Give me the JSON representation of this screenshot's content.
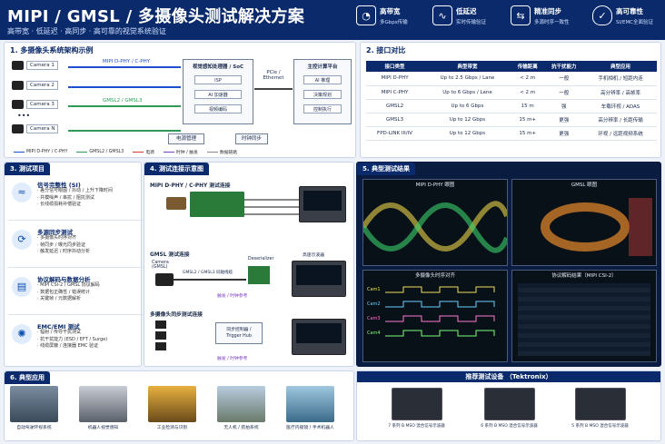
{
  "header": {
    "title": "MIPI / GMSL / 多摄像头测试解决方案",
    "subtitle": "高带宽 · 低延迟 · 高同步 · 高可靠的视觉系统验证",
    "features": [
      {
        "icon": "speedometer-icon",
        "title": "高带宽",
        "sub": "多Gbps传输"
      },
      {
        "icon": "pulse-icon",
        "title": "低延迟",
        "sub": "实时传输验证"
      },
      {
        "icon": "sync-icon",
        "title": "精准同步",
        "sub": "多源时序一致性"
      },
      {
        "icon": "shield-icon",
        "title": "高可靠性",
        "sub": "SI/EMC全面验证"
      }
    ]
  },
  "arch": {
    "title": "1. 多摄像头系统架构示例",
    "cameras": [
      "Camera 1",
      "Camera 2",
      "Camera 3",
      "Camera N"
    ],
    "link1": "MIPI D-PHY / C-PHY",
    "link2": "GMSL2 / GMSL3",
    "soc": "视觉感知处理器 / SoC",
    "soc_items": [
      "ISP",
      "AI 加速器",
      "视频编码"
    ],
    "pcie": "PCIe / Ethernet",
    "host": "主控计算平台",
    "host_items": [
      "AI 推理",
      "决策规划",
      "控制执行"
    ],
    "power": "电源管理",
    "clock": "时钟同步",
    "legend": [
      "MIPI D-PHY / C-PHY",
      "GMSL2 / GMSL3",
      "电源",
      "时钟 / 触发",
      "数据链路"
    ]
  },
  "compare": {
    "title": "2. 接口对比",
    "headers": [
      "接口类型",
      "典型带宽",
      "传输距离",
      "抗干扰能力",
      "典型应用"
    ],
    "rows": [
      [
        "MIPI D-PHY",
        "Up to 2.5 Gbps / Lane",
        "< 2 m",
        "一般",
        "手机相机 / 短距内连"
      ],
      [
        "MIPI C-PHY",
        "Up to 6 Gbps / Lane",
        "< 2 m",
        "一般",
        "高分辨率 / 高帧率"
      ],
      [
        "GMSL2",
        "Up to 6 Gbps",
        "15 m",
        "强",
        "车载环视 / ADAS"
      ],
      [
        "GMSL3",
        "Up to 12 Gbps",
        "15 m+",
        "更强",
        "高分辨率 / 长距传输"
      ],
      [
        "FPD-LINK III/IV",
        "Up to 12 Gbps",
        "15 m+",
        "更强",
        "环视 / 远距视频系统"
      ]
    ]
  },
  "tests": {
    "title": "3. 测试项目",
    "items": [
      {
        "icon": "eye-diagram-icon",
        "title": "信号完整性 (SI)",
        "lines": [
          "· 差分信号眼图 / 抖动 / 上升下降时间",
          "· 共模噪声 / 串扰 / 阻抗测试",
          "· 长线缆损耗补偿验证"
        ]
      },
      {
        "icon": "sync-icon",
        "title": "多源同步测试",
        "lines": [
          "· 多摄像头时序对齐",
          "· 帧同步 / 曝光同步验证",
          "· 触发延迟 / 时序抖动分析"
        ]
      },
      {
        "icon": "document-icon",
        "title": "协议解码与数据分析",
        "lines": [
          "· MIPI CSI-2 / GMSL 协议解码",
          "· 数据包正确性 / 错误统计",
          "· 关键帧 / 元数据解析"
        ]
      },
      {
        "icon": "emc-icon",
        "title": "EMC/EMI 测试",
        "lines": [
          "· 辐射 / 传导干扰测试",
          "· 抗干扰能力 (ESD / EFT / Surge)",
          "· 线缆屏蔽 / 连接器 EMC 验证"
        ]
      }
    ]
  },
  "setup": {
    "title": "4. 测试连接示意图",
    "sec1": "MIPI D-PHY / C-PHY 测试连接",
    "sec2": "GMSL 测试连接",
    "cam_gmsl": "Camera\n(GMSL)",
    "gmsl_cable": "GMSL2 / GMSL3 同轴线缆",
    "deser": "Deserializer",
    "hs_scope": "高速示波器",
    "trig_ref": "触发 / 时钟参考",
    "sec3": "多摄像头同步测试连接",
    "trigger_hub": "同步控制器 /\nTrigger Hub",
    "trig_ref2": "触发 / 时钟参考"
  },
  "results": {
    "title": "5. 典型测试结果",
    "shots": [
      "MIPI D-PHY 眼图",
      "GMSL 眼图",
      "多摄像头时序对齐",
      "协议解码结果（MIPI CSI-2）"
    ],
    "cams": [
      "Cam1",
      "Cam2",
      "Cam3",
      "Cam4"
    ]
  },
  "apps": {
    "title": "6. 典型应用",
    "items": [
      "自动驾驶环视系统",
      "机器人视觉感知",
      "工业检测与识别",
      "无人机 / 航拍系统",
      "医疗内窥镜 / 手术机器人"
    ]
  },
  "equip": {
    "title": "推荐测试设备 （Tektronix）",
    "items": [
      "7 系列 B MSO 混合信号示波器",
      "6 系列 B MSO 混合信号示波器",
      "5 系列 B MSO 混合信号示波器"
    ]
  }
}
